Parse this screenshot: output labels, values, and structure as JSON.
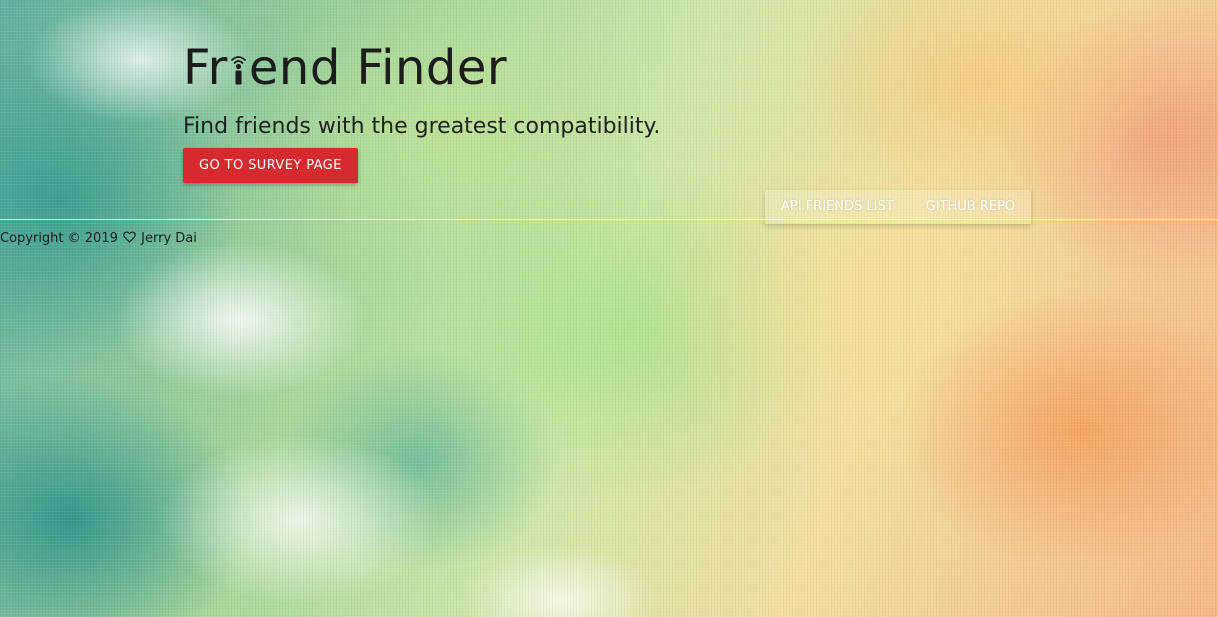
{
  "hero": {
    "title_before_icon": "Fr",
    "title_icon": "person-i-icon",
    "title_after_icon": "end Finder",
    "subtitle": "Find friends with the greatest compatibility.",
    "survey_button_label": "GO TO SURVEY PAGE"
  },
  "footer": {
    "links": [
      {
        "label": "API FRIENDS LIST"
      },
      {
        "label": "GITHUB REPO"
      }
    ],
    "copyright_before_icon": "Copyright © 2019",
    "copyright_icon": "heart-outline-icon",
    "copyright_author": "Jerry Dai"
  },
  "colors": {
    "button_red": "#d52b2f",
    "title_text": "#1c1c1c",
    "nav_text": "#ffffff"
  }
}
